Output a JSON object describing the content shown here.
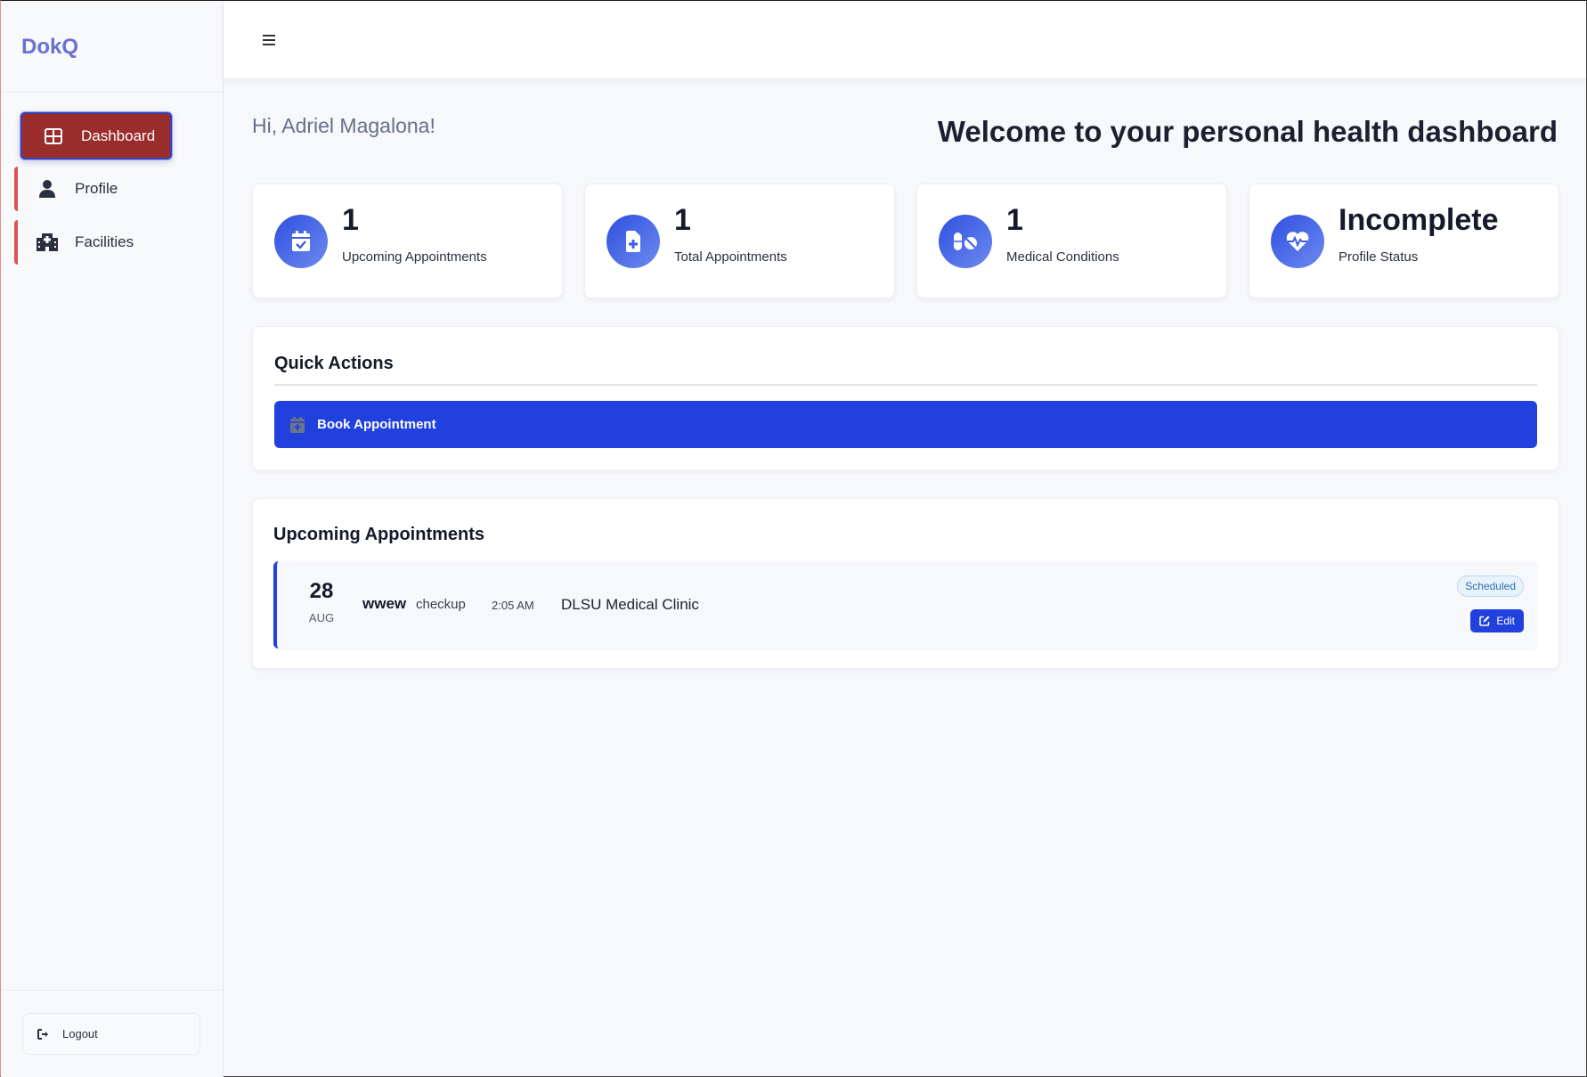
{
  "app": {
    "brand": "DokQ"
  },
  "sidebar": {
    "items": [
      {
        "label": "Dashboard",
        "icon": "dashboard-grid-icon"
      },
      {
        "label": "Profile",
        "icon": "user-icon"
      },
      {
        "label": "Facilities",
        "icon": "hospital-icon"
      }
    ],
    "logout_label": "Logout"
  },
  "header": {
    "greeting": "Hi, Adriel Magalona!",
    "welcome": "Welcome to your personal health dashboard"
  },
  "stats": [
    {
      "value": "1",
      "label": "Upcoming Appointments",
      "icon": "calendar-check-icon"
    },
    {
      "value": "1",
      "label": "Total Appointments",
      "icon": "file-medical-icon"
    },
    {
      "value": "1",
      "label": "Medical Conditions",
      "icon": "pills-icon"
    },
    {
      "value": "Incomplete",
      "label": "Profile Status",
      "icon": "heart-pulse-icon"
    }
  ],
  "quick_actions": {
    "title": "Quick Actions",
    "book_label": "Book Appointment"
  },
  "upcoming": {
    "title": "Upcoming Appointments",
    "appointments": [
      {
        "day": "28",
        "month": "AUG",
        "name": "wwew",
        "type": "checkup",
        "time": "2:05 AM",
        "clinic": "DLSU Medical Clinic",
        "status": "Scheduled",
        "edit_label": "Edit"
      }
    ]
  },
  "colors": {
    "brand": "#6a6fd0",
    "active_nav": "#9b2c2c",
    "primary": "#2140de",
    "nav_accent": "#d9534f"
  }
}
